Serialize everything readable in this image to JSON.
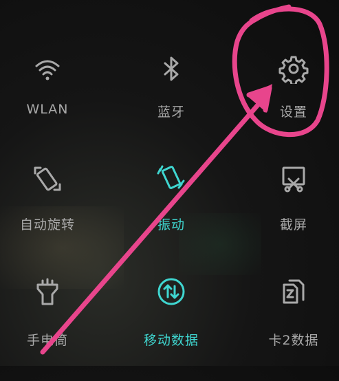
{
  "quick_settings": {
    "tiles": [
      {
        "label": "WLAN",
        "icon": "wifi-icon",
        "active": false
      },
      {
        "label": "蓝牙",
        "icon": "bluetooth-icon",
        "active": false
      },
      {
        "label": "设置",
        "icon": "gear-icon",
        "active": false
      },
      {
        "label": "自动旋转",
        "icon": "auto-rotate-icon",
        "active": false
      },
      {
        "label": "振动",
        "icon": "vibrate-icon",
        "active": true
      },
      {
        "label": "截屏",
        "icon": "screenshot-icon",
        "active": false
      },
      {
        "label": "手电筒",
        "icon": "flashlight-icon",
        "active": false
      },
      {
        "label": "移动数据",
        "icon": "mobile-data-icon",
        "active": true
      },
      {
        "label": "卡2数据",
        "icon": "sim2-data-icon",
        "active": false
      }
    ]
  },
  "colors": {
    "inactive": "#a9a9a9",
    "active": "#3fd6d0",
    "annotation": "#e8458c"
  }
}
